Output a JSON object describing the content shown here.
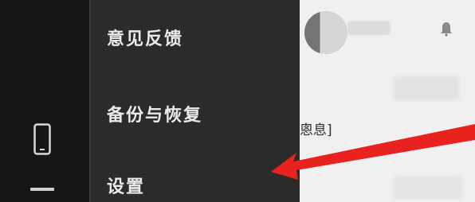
{
  "menu": {
    "items": [
      {
        "label": "意见反馈",
        "icon": ""
      },
      {
        "label": "备份与恢复",
        "icon": ""
      },
      {
        "label": "设置",
        "icon": ""
      }
    ]
  },
  "left_rail": {
    "icons": [
      "phone-icon",
      "hamburger-icon"
    ]
  },
  "page": {
    "message_snippet": "悤息]",
    "top_right_icon": "bell-icon"
  },
  "annotation": {
    "arrow_color": "#e8221f"
  },
  "colors": {
    "menu_bg": "#2b2b2b",
    "rail_bg": "#161616",
    "menu_text": "#eaeaea",
    "page_bg": "#f0f0f0"
  }
}
